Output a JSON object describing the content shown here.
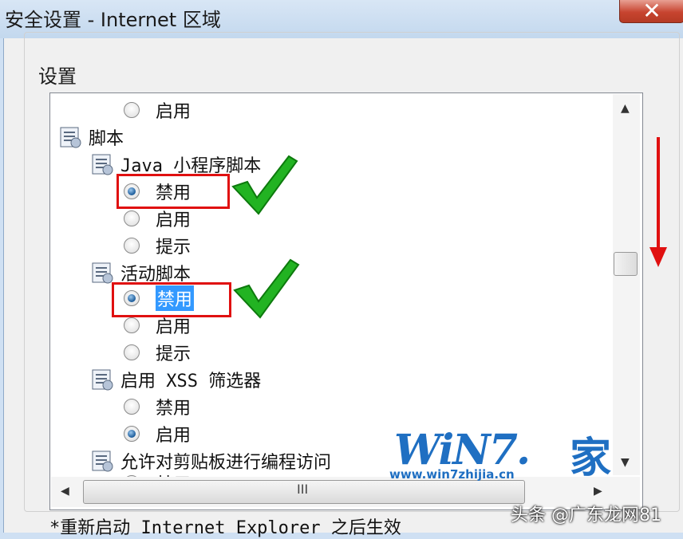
{
  "window": {
    "title": "安全设置 - Internet 区域",
    "close_glyph": "✕"
  },
  "group": {
    "label": "设置"
  },
  "tree": {
    "items": [
      {
        "kind": "radio",
        "label": "启用",
        "checked": false
      },
      {
        "kind": "node",
        "label": "脚本"
      },
      {
        "kind": "subnode",
        "label": "Java 小程序脚本"
      },
      {
        "kind": "radio",
        "label": "禁用",
        "checked": true
      },
      {
        "kind": "radio",
        "label": "启用",
        "checked": false
      },
      {
        "kind": "radio",
        "label": "提示",
        "checked": false
      },
      {
        "kind": "subnode",
        "label": "活动脚本"
      },
      {
        "kind": "radio",
        "label": "禁用",
        "checked": true,
        "selected": true
      },
      {
        "kind": "radio",
        "label": "启用",
        "checked": false
      },
      {
        "kind": "radio",
        "label": "提示",
        "checked": false
      },
      {
        "kind": "subnode",
        "label": "启用 XSS 筛选器"
      },
      {
        "kind": "radio",
        "label": "禁用",
        "checked": false
      },
      {
        "kind": "radio",
        "label": "启用",
        "checked": true
      },
      {
        "kind": "subnode",
        "label": "允许对剪贴板进行编程访问"
      },
      {
        "kind": "radio",
        "label": "禁用",
        "checked": false
      }
    ]
  },
  "scrollbar": {
    "up_glyph": "▲",
    "down_glyph": "▼",
    "left_glyph": "◀",
    "right_glyph": "▶",
    "grip_glyph": "III"
  },
  "footnote": "*重新启动 Internet Explorer 之后生效",
  "watermark": {
    "logo": "WiN7.",
    "jia": "家",
    "url": "www.win7zhijia.cn",
    "bottom": "头条 @广东龙网81"
  },
  "colors": {
    "highlight_box": "#e01010",
    "checkmark": "#22b322",
    "selection": "#3399ff"
  }
}
